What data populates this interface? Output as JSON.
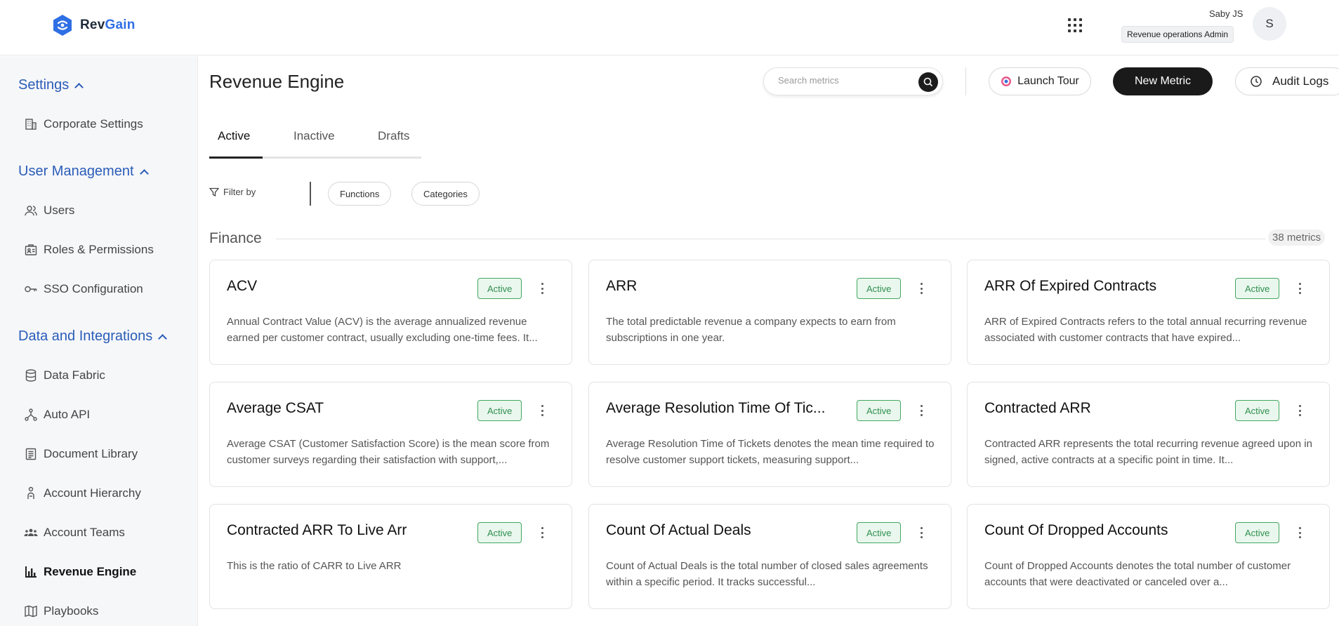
{
  "header": {
    "logo": {
      "part1": "Rev",
      "part2": "Gain"
    },
    "user": {
      "name": "Saby JS",
      "role": "Revenue operations Admin",
      "initial": "S"
    },
    "apps_icon": "grid-icon"
  },
  "sidebar": {
    "sections": [
      {
        "label": "Settings",
        "items": [
          {
            "label": "Corporate Settings",
            "icon": "building-icon"
          }
        ]
      },
      {
        "label": "User Management",
        "items": [
          {
            "label": "Users",
            "icon": "users-icon"
          },
          {
            "label": "Roles & Permissions",
            "icon": "roles-icon"
          },
          {
            "label": "SSO Configuration",
            "icon": "key-icon"
          }
        ]
      },
      {
        "label": "Data and Integrations",
        "items": [
          {
            "label": "Data Fabric",
            "icon": "database-icon"
          },
          {
            "label": "Auto API",
            "icon": "api-icon"
          },
          {
            "label": "Document Library",
            "icon": "document-icon"
          },
          {
            "label": "Account Hierarchy",
            "icon": "hierarchy-icon"
          },
          {
            "label": "Account Teams",
            "icon": "team-icon"
          },
          {
            "label": "Revenue Engine",
            "icon": "chart-icon",
            "active": true
          },
          {
            "label": "Playbooks",
            "icon": "book-icon"
          }
        ]
      }
    ]
  },
  "main": {
    "title": "Revenue Engine",
    "search": {
      "placeholder": "Search metrics",
      "value": ""
    },
    "buttons": {
      "tour": "Launch Tour",
      "new_metric": "New Metric",
      "audit": "Audit Logs"
    },
    "tabs": [
      {
        "label": "Active",
        "active": true
      },
      {
        "label": "Inactive"
      },
      {
        "label": "Drafts"
      }
    ],
    "filter": {
      "label": "Filter by",
      "chips": [
        "Functions",
        "Categories"
      ]
    },
    "group": {
      "title": "Finance",
      "count": "38 metrics"
    },
    "cards": [
      {
        "title": "ACV",
        "status": "Active",
        "desc": "Annual Contract Value (ACV) is the average annualized revenue earned per customer contract, usually excluding one-time fees. It..."
      },
      {
        "title": "ARR",
        "status": "Active",
        "desc": "The total predictable revenue a company expects to earn from subscriptions in one year."
      },
      {
        "title": "ARR Of Expired Contracts",
        "status": "Active",
        "desc": "ARR of Expired Contracts refers to the total annual recurring revenue associated with customer contracts that have expired..."
      },
      {
        "title": "Average CSAT",
        "status": "Active",
        "desc": "Average CSAT (Customer Satisfaction Score) is the mean score from customer surveys regarding their satisfaction with support,..."
      },
      {
        "title": "Average Resolution Time Of Tic...",
        "status": "Active",
        "desc": "Average Resolution Time of Tickets denotes the mean time required to resolve customer support tickets, measuring support..."
      },
      {
        "title": "Contracted ARR",
        "status": "Active",
        "desc": "Contracted ARR represents the total recurring revenue agreed upon in signed, active contracts at a specific point in time. It..."
      },
      {
        "title": "Contracted ARR To Live Arr",
        "status": "Active",
        "desc": "This is the ratio of CARR to Live ARR"
      },
      {
        "title": "Count Of Actual Deals",
        "status": "Active",
        "desc": "Count of Actual Deals is the total number of closed sales agreements within a specific period. It tracks successful..."
      },
      {
        "title": "Count Of Dropped Accounts",
        "status": "Active",
        "desc": "Count of Dropped Accounts denotes the total number of customer accounts that were deactivated or canceled over a..."
      }
    ]
  },
  "colors": {
    "accent": "#2a5cb8",
    "active_badge": "#2f8f4e",
    "primary_button": "#1a1a1a"
  }
}
